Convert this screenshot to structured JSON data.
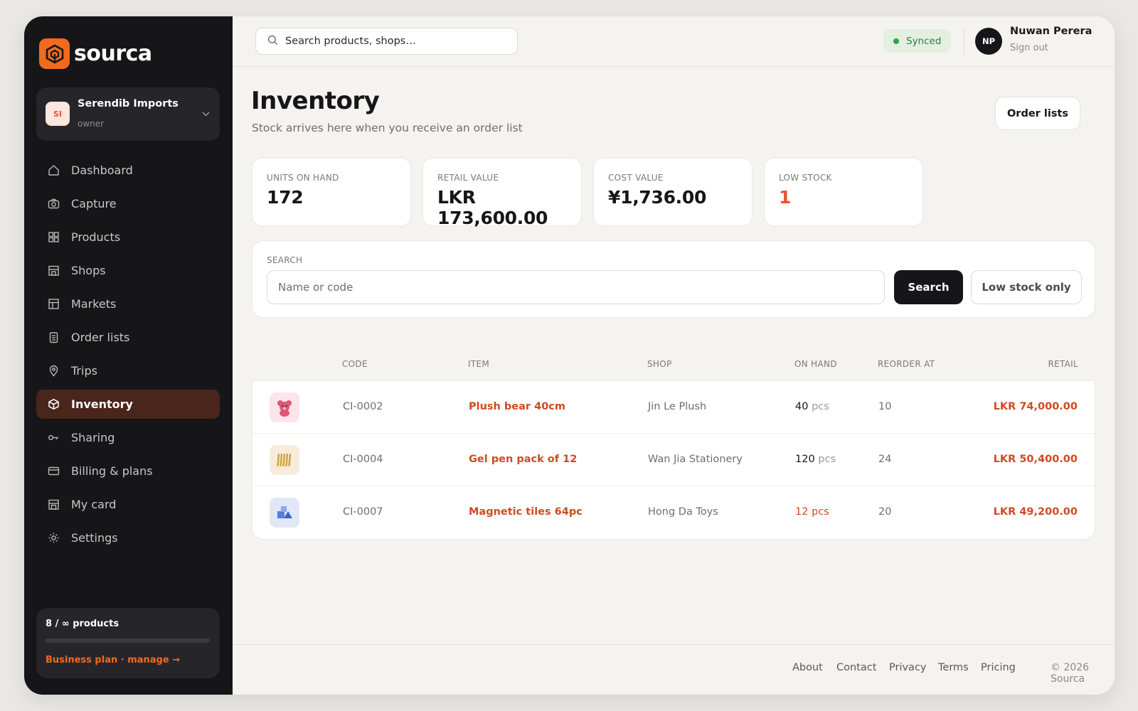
{
  "app": {
    "brand": "sourca"
  },
  "org": {
    "initials": "SI",
    "name": "Serendib Imports",
    "role": "owner"
  },
  "nav": [
    {
      "label": "Dashboard",
      "icon": "home-icon"
    },
    {
      "label": "Capture",
      "icon": "camera-icon"
    },
    {
      "label": "Products",
      "icon": "grid-icon"
    },
    {
      "label": "Shops",
      "icon": "store-icon"
    },
    {
      "label": "Markets",
      "icon": "layout-icon"
    },
    {
      "label": "Order lists",
      "icon": "clipboard-icon"
    },
    {
      "label": "Trips",
      "icon": "pin-icon"
    },
    {
      "label": "Inventory",
      "icon": "box-icon",
      "active": true
    },
    {
      "label": "Sharing",
      "icon": "key-icon"
    },
    {
      "label": "Billing & plans",
      "icon": "card-icon"
    },
    {
      "label": "My card",
      "icon": "id-card-icon"
    },
    {
      "label": "Settings",
      "icon": "gear-icon"
    }
  ],
  "plan": {
    "count": "8 / ∞ products",
    "link": "Business plan · manage →",
    "usage_fraction": 0
  },
  "topbar": {
    "search_placeholder": "Search products, shops…",
    "sync_status": "Synced",
    "user_initials": "NP",
    "user_name": "Nuwan Perera",
    "signout": "Sign out"
  },
  "page": {
    "title": "Inventory",
    "subtitle": "Stock arrives here when you receive an order list",
    "order_lists_button": "Order lists"
  },
  "stats": [
    {
      "label": "UNITS ON HAND",
      "value": "172"
    },
    {
      "label": "RETAIL VALUE",
      "value": "LKR 173,600.00"
    },
    {
      "label": "COST VALUE",
      "value": "¥1,736.00"
    },
    {
      "label": "LOW STOCK",
      "value": "1",
      "warn": true
    }
  ],
  "search": {
    "label": "SEARCH",
    "placeholder": "Name or code",
    "button": "Search",
    "toggle": "Low stock only"
  },
  "table": {
    "headers": [
      "CODE",
      "ITEM",
      "SHOP",
      "ON HAND",
      "REORDER AT",
      "RETAIL"
    ],
    "rows": [
      {
        "thumb": "bear-icon",
        "code": "CI-0002",
        "item": "Plush bear 40cm",
        "shop": "Jin Le Plush",
        "on_hand": "40",
        "unit": "pcs",
        "reorder_at": "10",
        "retail": "LKR 74,000.00",
        "low": false
      },
      {
        "thumb": "pens-icon",
        "code": "CI-0004",
        "item": "Gel pen pack of 12",
        "shop": "Wan Jia Stationery",
        "on_hand": "120",
        "unit": "pcs",
        "reorder_at": "24",
        "retail": "LKR 50,400.00",
        "low": false
      },
      {
        "thumb": "tiles-icon",
        "code": "CI-0007",
        "item": "Magnetic tiles 64pc",
        "shop": "Hong Da Toys",
        "on_hand": "12",
        "unit": "pcs",
        "reorder_at": "20",
        "retail": "LKR 49,200.00",
        "low": true
      }
    ]
  },
  "footer": {
    "links": [
      "About",
      "Contact",
      "Privacy",
      "Terms",
      "Pricing"
    ],
    "copyright": "© 2026 Sourca"
  },
  "colors": {
    "accent": "#f26a1d",
    "danger": "#d04a22",
    "sidebar": "#161619",
    "active_nav": "#4a251c"
  }
}
